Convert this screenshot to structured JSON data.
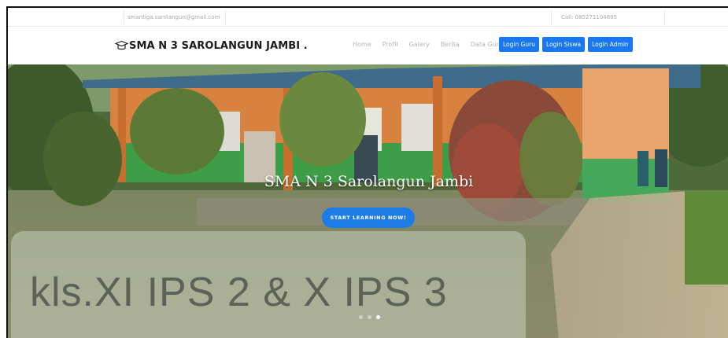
{
  "topbar": {
    "email": "smantiga.sarolangun@gmail.com",
    "phone": "Call: 085271104695"
  },
  "brand": {
    "name": "SMA N 3 SAROLANGUN JAMBI .",
    "icon": "graduation-cap-icon"
  },
  "nav": {
    "items": [
      {
        "label": "Home"
      },
      {
        "label": "Profil"
      },
      {
        "label": "Galery"
      },
      {
        "label": "Berita"
      },
      {
        "label": "Data Guru"
      }
    ],
    "buttons": [
      {
        "label": "Login Guru"
      },
      {
        "label": "Login Siswa"
      },
      {
        "label": "Login Admin"
      }
    ]
  },
  "hero": {
    "title": "SMA N 3 Sarolangun Jambi",
    "cta_label": "START LEARNING NOW!",
    "caption": "kls.XI IPS 2 & X IPS 3",
    "slides_count": 3,
    "active_slide": 3
  },
  "colors": {
    "accent": "#1877f2",
    "cta": "#1e7ce8"
  }
}
